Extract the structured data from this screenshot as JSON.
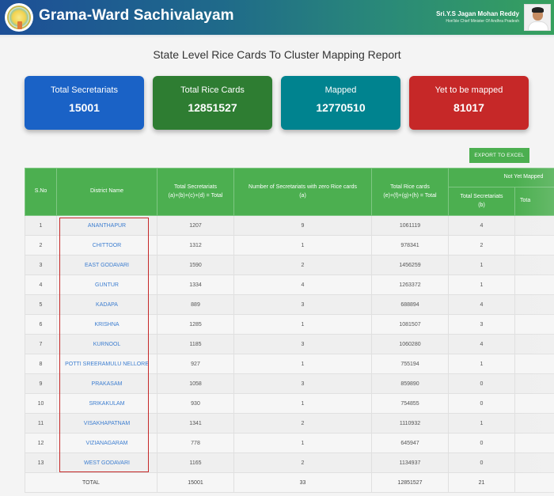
{
  "header": {
    "app_title": "Grama-Ward Sachivalayam",
    "logo_icon": "ap-state-emblem-icon",
    "leader_name": "Sri.Y.S Jagan Mohan Reddy",
    "leader_title": "Hon'ble Chief Minister Of Andhra Pradesh",
    "leader_photo": "chief-minister-photo"
  },
  "page_title": "State Level Rice Cards To Cluster Mapping Report",
  "stats": [
    {
      "label": "Total Secretariats",
      "value": "15001",
      "color": "#1a62c6"
    },
    {
      "label": "Total Rice Cards",
      "value": "12851527",
      "color": "#2e7d32"
    },
    {
      "label": "Mapped",
      "value": "12770510",
      "color": "#00838f"
    },
    {
      "label": "Yet to be mapped",
      "value": "81017",
      "color": "#c62828"
    }
  ],
  "export_button": "EXPORT TO EXCEL",
  "table": {
    "headers": {
      "sno": "S.No",
      "district": "District Name",
      "total_secretariats": "Total Secretariats",
      "total_secretariats_formula": "(a)+(b)+(c)+(d) = Total",
      "zero_rice_cards": "Number of Secretariats with zero Rice cards",
      "zero_rice_cards_formula": "(a)",
      "total_rice_cards": "Total Rice cards",
      "total_rice_cards_formula": "(e)+(f)+(g)+(h) = Total",
      "not_yet_mapped_group": "Not Yet Mapped",
      "nym_total_secretariats": "Total Secretariats",
      "nym_total_secretariats_formula": "(b)",
      "nym_next_col_partial": "Tota"
    },
    "rows": [
      {
        "sno": "1",
        "district": "ANANTHAPUR",
        "total_secretariats": "1207",
        "zero_rice_cards": "9",
        "total_rice_cards": "1061119",
        "nym_secretariats": "4"
      },
      {
        "sno": "2",
        "district": "CHITTOOR",
        "total_secretariats": "1312",
        "zero_rice_cards": "1",
        "total_rice_cards": "978341",
        "nym_secretariats": "2"
      },
      {
        "sno": "3",
        "district": "EAST GODAVARI",
        "total_secretariats": "1590",
        "zero_rice_cards": "2",
        "total_rice_cards": "1456259",
        "nym_secretariats": "1"
      },
      {
        "sno": "4",
        "district": "GUNTUR",
        "total_secretariats": "1334",
        "zero_rice_cards": "4",
        "total_rice_cards": "1263372",
        "nym_secretariats": "1"
      },
      {
        "sno": "5",
        "district": "KADAPA",
        "total_secretariats": "889",
        "zero_rice_cards": "3",
        "total_rice_cards": "688894",
        "nym_secretariats": "4"
      },
      {
        "sno": "6",
        "district": "KRISHNA",
        "total_secretariats": "1285",
        "zero_rice_cards": "1",
        "total_rice_cards": "1081507",
        "nym_secretariats": "3"
      },
      {
        "sno": "7",
        "district": "KURNOOL",
        "total_secretariats": "1185",
        "zero_rice_cards": "3",
        "total_rice_cards": "1060280",
        "nym_secretariats": "4"
      },
      {
        "sno": "8",
        "district": "POTTI SREERAMULU NELLORE",
        "total_secretariats": "927",
        "zero_rice_cards": "1",
        "total_rice_cards": "755194",
        "nym_secretariats": "1"
      },
      {
        "sno": "9",
        "district": "PRAKASAM",
        "total_secretariats": "1058",
        "zero_rice_cards": "3",
        "total_rice_cards": "859890",
        "nym_secretariats": "0"
      },
      {
        "sno": "10",
        "district": "SRIKAKULAM",
        "total_secretariats": "930",
        "zero_rice_cards": "1",
        "total_rice_cards": "754855",
        "nym_secretariats": "0"
      },
      {
        "sno": "11",
        "district": "VISAKHAPATNAM",
        "total_secretariats": "1341",
        "zero_rice_cards": "2",
        "total_rice_cards": "1110932",
        "nym_secretariats": "1"
      },
      {
        "sno": "12",
        "district": "VIZIANAGARAM",
        "total_secretariats": "778",
        "zero_rice_cards": "1",
        "total_rice_cards": "645947",
        "nym_secretariats": "0"
      },
      {
        "sno": "13",
        "district": "WEST GODAVARI",
        "total_secretariats": "1165",
        "zero_rice_cards": "2",
        "total_rice_cards": "1134937",
        "nym_secretariats": "0"
      }
    ],
    "total": {
      "label": "TOTAL",
      "total_secretariats": "15001",
      "zero_rice_cards": "33",
      "total_rice_cards": "12851527",
      "nym_secretariats": "21"
    }
  },
  "annotation": {
    "highlight_color": "#c62828",
    "highlighted_column": "District Name"
  }
}
